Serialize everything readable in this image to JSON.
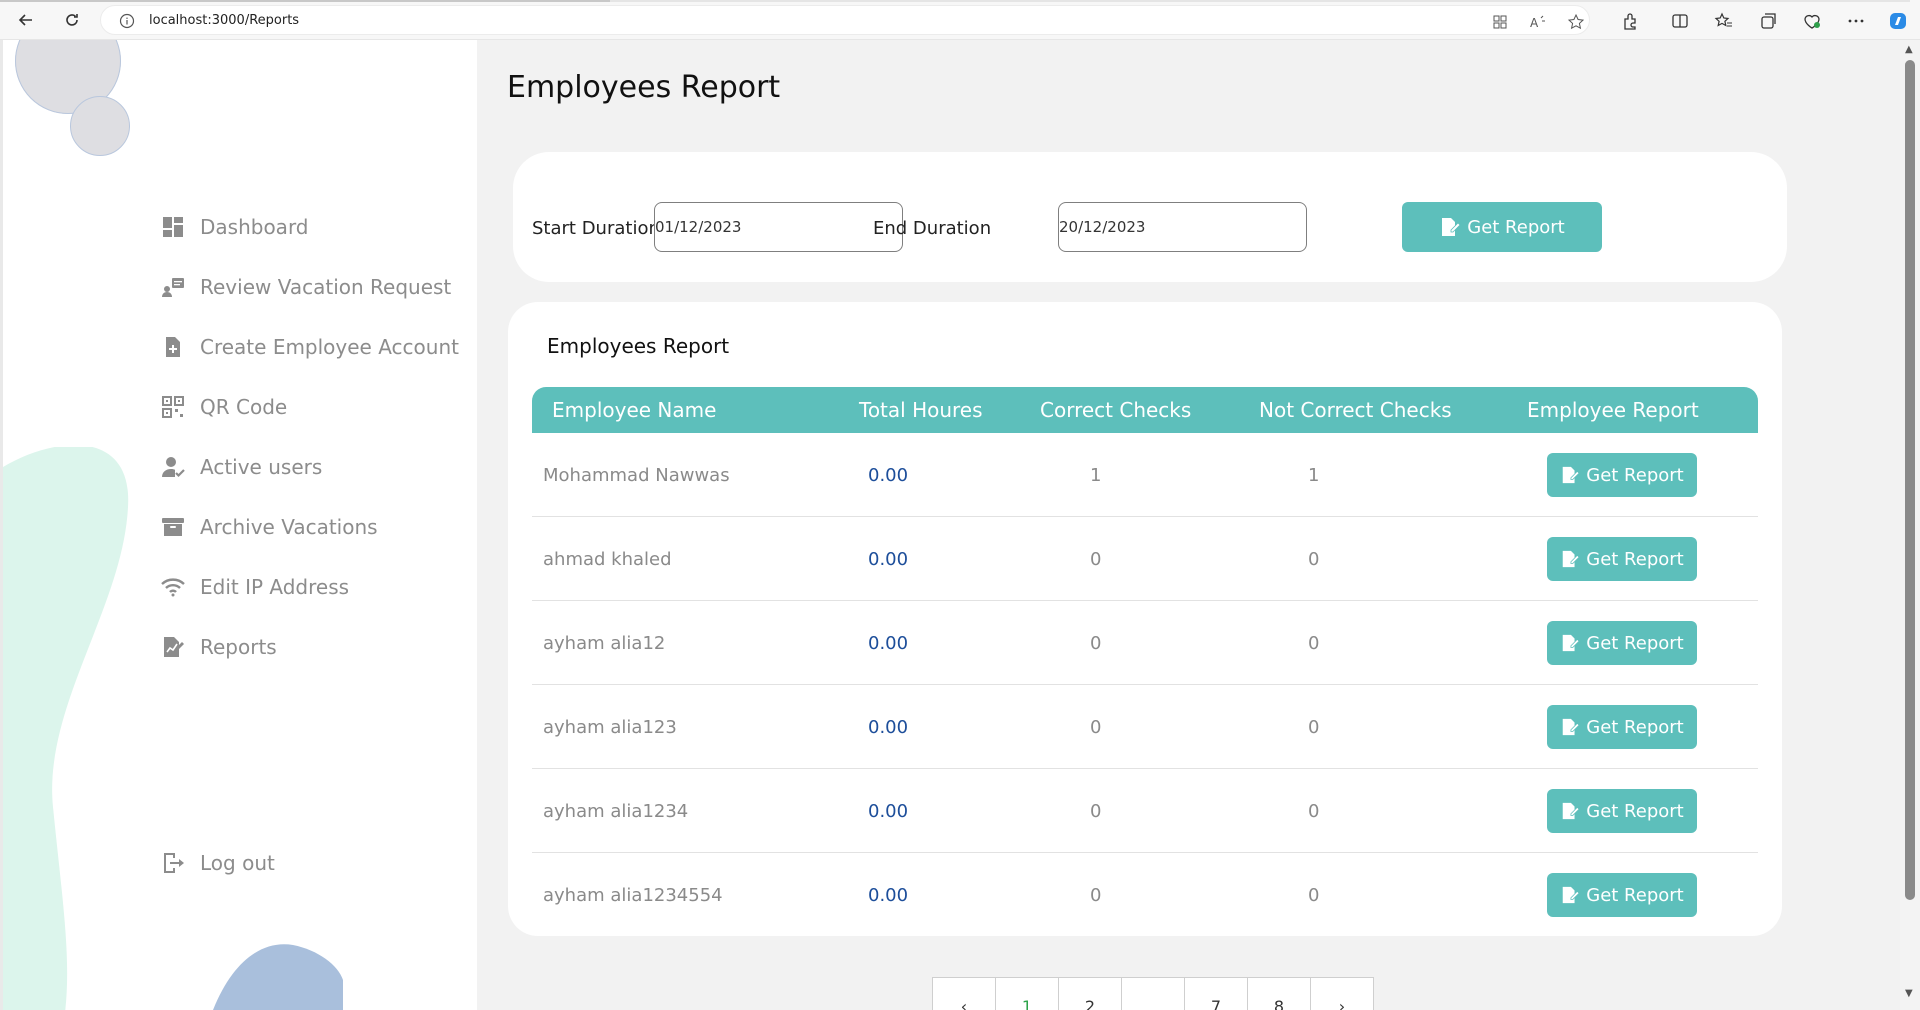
{
  "browser": {
    "url": "localhost:3000/Reports"
  },
  "sidebar": {
    "items": [
      {
        "label": "Dashboard",
        "icon": "dashboard-icon"
      },
      {
        "label": "Review Vacation Request",
        "icon": "review-request-icon"
      },
      {
        "label": "Create Employee Account",
        "icon": "file-add-icon"
      },
      {
        "label": "QR Code",
        "icon": "qr-code-icon"
      },
      {
        "label": "Active users",
        "icon": "user-check-icon"
      },
      {
        "label": "Archive Vacations",
        "icon": "archive-icon"
      },
      {
        "label": "Edit IP Address",
        "icon": "wifi-icon"
      },
      {
        "label": "Reports",
        "icon": "report-icon"
      }
    ],
    "logout_label": "Log out"
  },
  "main": {
    "title": "Employees Report",
    "filter": {
      "start_label": "Start Duration",
      "start_value": "01/12/2023",
      "end_label": "End Duration",
      "end_value": "20/12/2023",
      "button_label": "Get Report"
    },
    "table": {
      "title": "Employees Report",
      "headers": [
        "Employee Name",
        "Total Houres",
        "Correct Checks",
        "Not Correct Checks",
        "Employee Report"
      ],
      "rows": [
        {
          "name": "Mohammad Nawwas",
          "hours": "0.00",
          "correct": "1",
          "not_correct": "1",
          "action": "Get Report"
        },
        {
          "name": "ahmad khaled",
          "hours": "0.00",
          "correct": "0",
          "not_correct": "0",
          "action": "Get Report"
        },
        {
          "name": "ayham alia12",
          "hours": "0.00",
          "correct": "0",
          "not_correct": "0",
          "action": "Get Report"
        },
        {
          "name": "ayham alia123",
          "hours": "0.00",
          "correct": "0",
          "not_correct": "0",
          "action": "Get Report"
        },
        {
          "name": "ayham alia1234",
          "hours": "0.00",
          "correct": "0",
          "not_correct": "0",
          "action": "Get Report"
        },
        {
          "name": "ayham alia1234554",
          "hours": "0.00",
          "correct": "0",
          "not_correct": "0",
          "action": "Get Report"
        }
      ]
    },
    "pagination": {
      "pages": [
        "‹",
        "1",
        "2",
        "...",
        "7",
        "8",
        "›"
      ],
      "active": "1"
    }
  },
  "colors": {
    "accent": "#5dbfbb",
    "hours_text": "#1d4e9a",
    "sidebar_text": "#8c8c8c"
  }
}
